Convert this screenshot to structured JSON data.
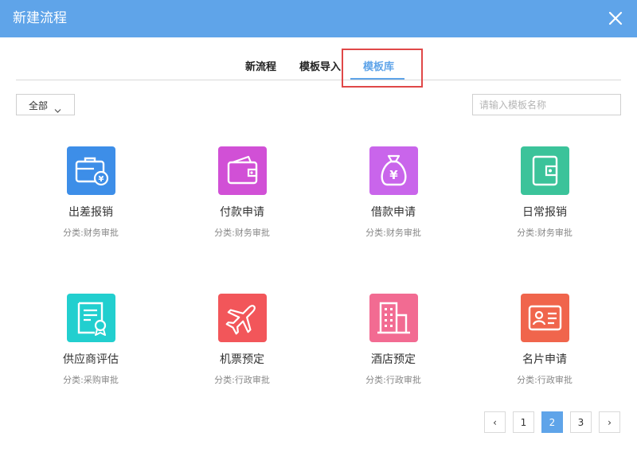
{
  "dialog": {
    "title": "新建流程"
  },
  "tabs": [
    {
      "label": "新流程"
    },
    {
      "label": "模板导入"
    },
    {
      "label": "模板库",
      "active": true
    }
  ],
  "filter": {
    "selected": "全部"
  },
  "search": {
    "placeholder": "请输入模板名称",
    "value": ""
  },
  "templates": [
    {
      "name": "出差报销",
      "category": "分类:财务审批",
      "icon": "briefcase-yen-icon",
      "color": "#3d8ee8"
    },
    {
      "name": "付款申请",
      "category": "分类:财务审批",
      "icon": "wallet-icon",
      "color": "#d150d6"
    },
    {
      "name": "借款申请",
      "category": "分类:财务审批",
      "icon": "money-bag-icon",
      "color": "#c965eb"
    },
    {
      "name": "日常报销",
      "category": "分类:财务审批",
      "icon": "wallet-card-icon",
      "color": "#3bc39a"
    },
    {
      "name": "供应商评估",
      "category": "分类:采购审批",
      "icon": "certificate-icon",
      "color": "#22cfcf"
    },
    {
      "name": "机票预定",
      "category": "分类:行政审批",
      "icon": "airplane-icon",
      "color": "#f2565a"
    },
    {
      "name": "酒店预定",
      "category": "分类:行政审批",
      "icon": "building-icon",
      "color": "#f26b92"
    },
    {
      "name": "名片申请",
      "category": "分类:行政审批",
      "icon": "id-card-icon",
      "color": "#f0654c"
    }
  ],
  "pagination": {
    "prev": "‹",
    "next": "›",
    "pages": [
      "1",
      "2",
      "3"
    ],
    "current": "2"
  },
  "colors": {
    "header": "#5fa4e9",
    "accent": "#5fa4e9",
    "highlight": "#e04848"
  }
}
